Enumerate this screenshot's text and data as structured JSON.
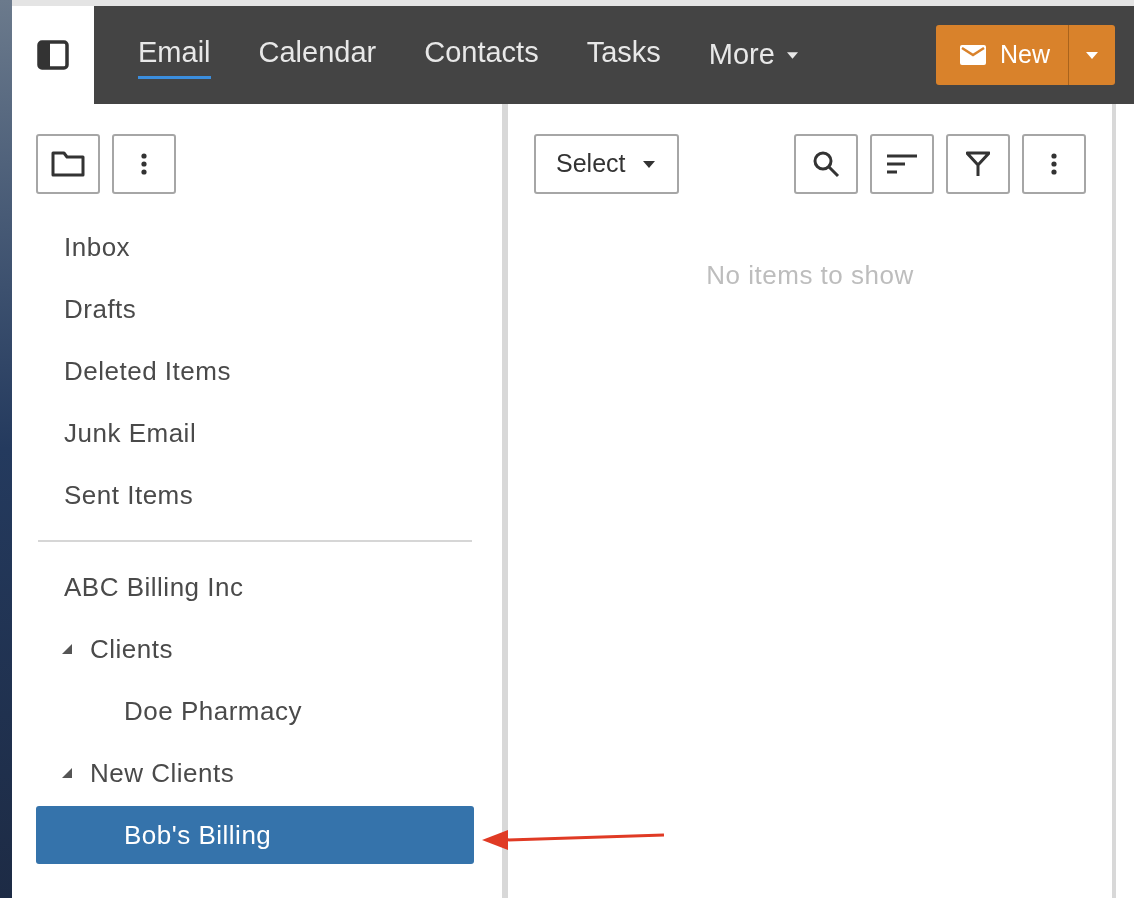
{
  "nav": {
    "tabs": [
      {
        "label": "Email",
        "selected": true
      },
      {
        "label": "Calendar",
        "selected": false
      },
      {
        "label": "Contacts",
        "selected": false
      },
      {
        "label": "Tasks",
        "selected": false
      }
    ],
    "more": "More",
    "new_button": "New"
  },
  "folders": {
    "items": [
      {
        "label": "Inbox",
        "selected": false
      },
      {
        "label": "Drafts",
        "selected": false
      },
      {
        "label": "Deleted Items",
        "selected": false
      },
      {
        "label": "Junk Email",
        "selected": false
      },
      {
        "label": "Sent Items",
        "selected": false
      }
    ],
    "account": {
      "label": "ABC Billing Inc",
      "children": [
        {
          "label": "Clients",
          "expanded": true,
          "selected": false,
          "children": [
            {
              "label": "Doe Pharmacy",
              "selected": false
            }
          ]
        },
        {
          "label": "New Clients",
          "expanded": true,
          "selected": false,
          "children": [
            {
              "label": "Bob's Billing",
              "selected": true
            }
          ]
        }
      ]
    }
  },
  "list": {
    "select": "Select",
    "empty_message": "No items to show"
  }
}
